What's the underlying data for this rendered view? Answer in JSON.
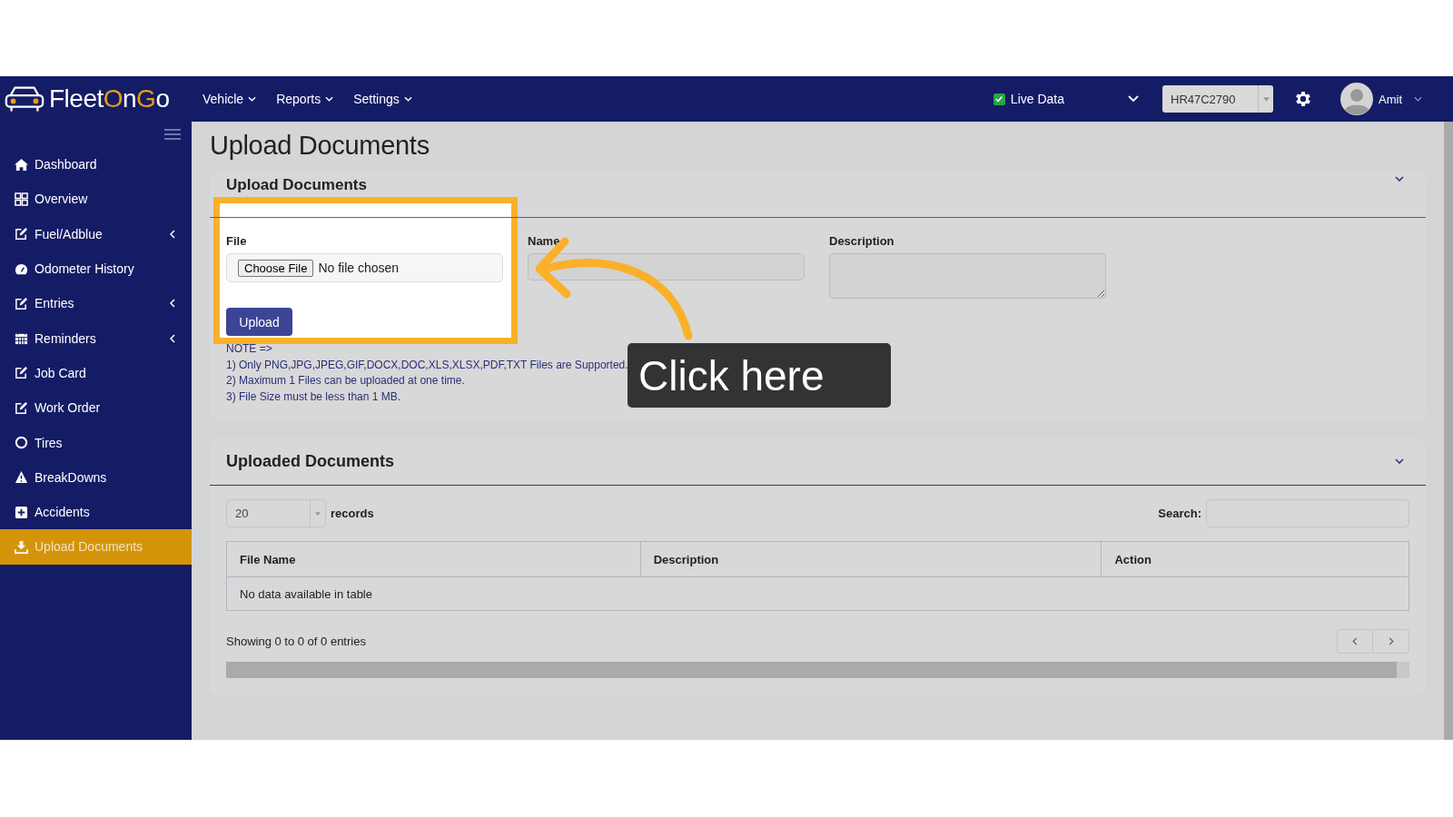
{
  "brand": {
    "parts": [
      {
        "text": "Fleet",
        "accent": false
      },
      {
        "text": "O",
        "accent": true
      },
      {
        "text": "n",
        "accent": false
      },
      {
        "text": "G",
        "accent": true
      },
      {
        "text": "o",
        "accent": false
      }
    ]
  },
  "nav": [
    {
      "label": "Vehicle"
    },
    {
      "label": "Reports"
    },
    {
      "label": "Settings"
    }
  ],
  "live_data": {
    "label": "Live Data",
    "checked": true
  },
  "vehicle_select": {
    "value": "HR47C2790"
  },
  "user": {
    "name": "Amit"
  },
  "sidebar": {
    "items": [
      {
        "label": "Dashboard",
        "has_submenu": false,
        "selected": false
      },
      {
        "label": "Overview",
        "has_submenu": false,
        "selected": false
      },
      {
        "label": "Fuel/Adblue",
        "has_submenu": true,
        "selected": false
      },
      {
        "label": "Odometer History",
        "has_submenu": false,
        "selected": false
      },
      {
        "label": "Entries",
        "has_submenu": true,
        "selected": false
      },
      {
        "label": "Reminders",
        "has_submenu": true,
        "selected": false
      },
      {
        "label": "Job Card",
        "has_submenu": false,
        "selected": false
      },
      {
        "label": "Work Order",
        "has_submenu": false,
        "selected": false
      },
      {
        "label": "Tires",
        "has_submenu": false,
        "selected": false
      },
      {
        "label": "BreakDowns",
        "has_submenu": false,
        "selected": false
      },
      {
        "label": "Accidents",
        "has_submenu": false,
        "selected": false
      },
      {
        "label": "Upload Documents",
        "has_submenu": false,
        "selected": true
      }
    ]
  },
  "page_title": "Upload Documents",
  "upload_card": {
    "title": "Upload Documents",
    "file_label": "File",
    "choose_button": "Choose File",
    "file_status": "No file chosen",
    "name_label": "Name",
    "description_label": "Description",
    "upload_button": "Upload",
    "notes": [
      "NOTE =>",
      "1) Only PNG,JPG,JPEG,GIF,DOCX,DOC,XLS,XLSX,PDF,TXT Files are Supported.",
      "2) Maximum 1 Files can be uploaded at one time.",
      "3) File Size must be less than 1 MB."
    ]
  },
  "callout": {
    "text": "Click here"
  },
  "uploaded_card": {
    "title": "Uploaded Documents",
    "page_length": "20",
    "records_label": "records",
    "search_label": "Search:",
    "columns": [
      "File Name",
      "Description",
      "Action"
    ],
    "empty_message": "No data available in table",
    "info": "Showing 0 to 0 of 0 entries"
  }
}
